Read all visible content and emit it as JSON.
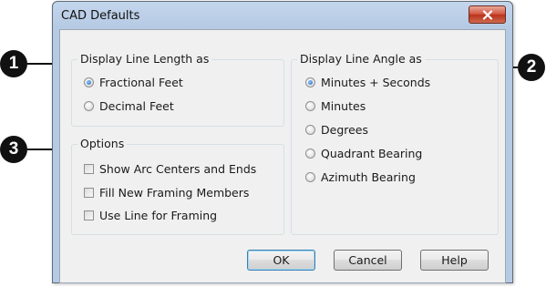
{
  "dialog": {
    "title": "CAD Defaults",
    "close_icon": "close-x-icon"
  },
  "line_length_group": {
    "legend": "Display Line Length as",
    "options": [
      {
        "label": "Fractional Feet",
        "checked": true
      },
      {
        "label": "Decimal Feet",
        "checked": false
      }
    ]
  },
  "options_group": {
    "legend": "Options",
    "items": [
      {
        "label": "Show Arc Centers and Ends",
        "checked": false
      },
      {
        "label": "Fill New Framing Members",
        "checked": false
      },
      {
        "label": "Use Line for Framing",
        "checked": false
      }
    ]
  },
  "line_angle_group": {
    "legend": "Display Line Angle as",
    "options": [
      {
        "label": "Minutes + Seconds",
        "checked": true
      },
      {
        "label": "Minutes",
        "checked": false
      },
      {
        "label": "Degrees",
        "checked": false
      },
      {
        "label": "Quadrant Bearing",
        "checked": false
      },
      {
        "label": "Azimuth Bearing",
        "checked": false
      }
    ]
  },
  "buttons": {
    "ok": "OK",
    "cancel": "Cancel",
    "help": "Help"
  },
  "callouts": [
    "1",
    "2",
    "3"
  ]
}
